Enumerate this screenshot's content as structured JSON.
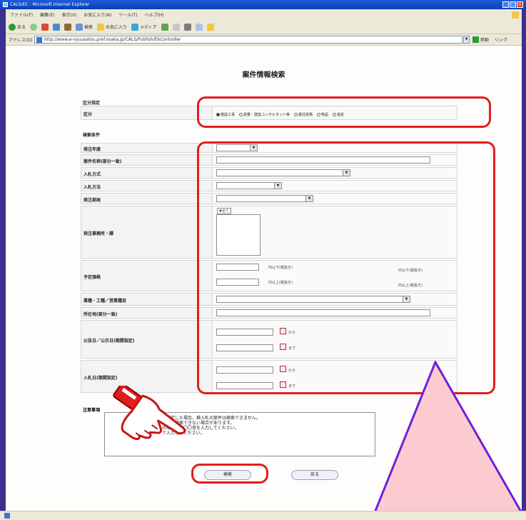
{
  "window": {
    "title": "CALS/EC - Microsoft Internet Explorer"
  },
  "menu": [
    "ファイル(F)",
    "編集(E)",
    "表示(V)",
    "お気に入り(A)",
    "ツール(T)",
    "ヘルプ(H)"
  ],
  "toolbar": {
    "back": "戻る",
    "search": "検索",
    "favorites": "お気に入り",
    "media": "メディア"
  },
  "address": {
    "label": "アドレス(D)",
    "url": "http://www.e-nyuusatsu.pref.osaka.jp/CALS/Publish/EbController",
    "go": "移動",
    "links": "リンク"
  },
  "page": {
    "title": "案件情報検索"
  },
  "section_kubun": {
    "heading": "区分指定",
    "row_label": "区分",
    "options": [
      "建設工事",
      "測量・建設コンサルタント等",
      "委託役務",
      "物品",
      "指定"
    ],
    "selected_index": 0
  },
  "section_search": {
    "heading": "検索条件",
    "fields": {
      "fiscal_year": "発注年度",
      "project_name": "案件名称(部分一致)",
      "bid_method": "入札方式",
      "bid_way": "入札方法",
      "ordering_dept": "発注部局",
      "office": "発注事務所・課",
      "estimated_price": "予定価格",
      "industry": "業種・工種／営業種目",
      "location": "所在地(部分一致)",
      "announce_date": "公告日／公示日(期間指定)",
      "bid_date": "入札日(期間指定)"
    },
    "office_select_all": "▼全て",
    "price_upper": "円以下(税抜き)",
    "price_lower": "円以上(税抜き)",
    "date_from": "から",
    "date_to": "まで"
  },
  "notes": {
    "label": "注意事項",
    "lines": [
      "を指定した場合、検入札の案件は検索できません。",
      "では、検索できない場合があります。",
      "の場合は、〇〇室を入力してください。",
      "で入力してください。"
    ]
  },
  "buttons": {
    "search": "検索",
    "back": "戻る"
  },
  "colors": {
    "highlight": "#e21d1d",
    "triangle_fill": "#fbcbd0",
    "triangle_stroke": "#6f1fd8",
    "frame": "#4a3aa6"
  }
}
